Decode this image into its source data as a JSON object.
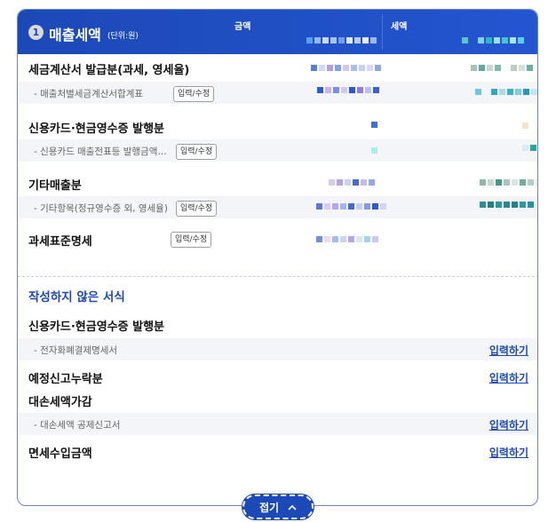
{
  "header": {
    "num": "1",
    "title": "매출세액",
    "unit": "(단위:원)",
    "col_amount": "금액",
    "col_tax": "세액"
  },
  "rows": {
    "r1": {
      "label": "세금계산서 발급분(과세, 영세율)"
    },
    "r1s": {
      "label": "- 매출처별세금계산서합계표",
      "button": "입력/수정"
    },
    "r2": {
      "label": "신용카드·현금영수증 발행분"
    },
    "r2s": {
      "label": "- 신용카드 매출전표등 발행금액…",
      "button": "입력/수정"
    },
    "r3": {
      "label": "기타매출분"
    },
    "r3s": {
      "label": "- 기타항목(정규영수증 외, 영세율)",
      "button": "입력/수정"
    },
    "r4": {
      "label": "과세표준명세",
      "button": "입력/수정"
    }
  },
  "unfilled": {
    "title": "작성하지 않은 서식",
    "items": {
      "a": {
        "label": "신용카드·현금영수증 발행분"
      },
      "as": {
        "label": "- 전자화폐결제명세서",
        "link": "입력하기"
      },
      "b": {
        "label": "예정신고누락분",
        "link": "입력하기"
      },
      "c": {
        "label": "대손세액가감"
      },
      "cs": {
        "label": "- 대손세액 공제신고서",
        "link": "입력하기"
      },
      "d": {
        "label": "면세수입금액",
        "link": "입력하기"
      }
    }
  },
  "fold_button": {
    "label": "접기",
    "icon": "chevron-up-icon"
  },
  "colors": {
    "accent": "#1c49b8",
    "sub_bg": "#f3f5f8"
  }
}
